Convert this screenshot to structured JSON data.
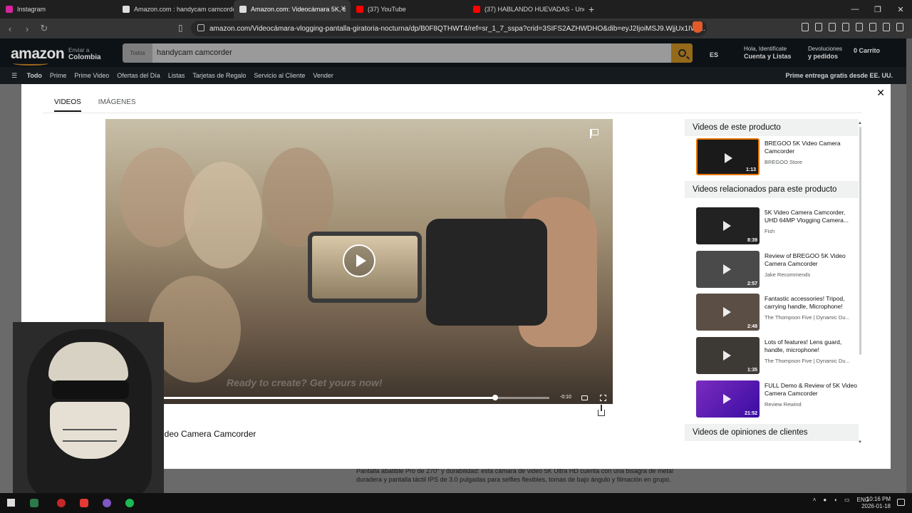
{
  "browser": {
    "tabs": [
      {
        "label": "Instagram",
        "color": "#d6249f"
      },
      {
        "label": "Amazon.com : handycam camcorder",
        "color": "#dddddd"
      },
      {
        "label": "Amazon.com: Videocámara 5K, c",
        "color": "#dddddd"
      },
      {
        "label": "(37) YouTube",
        "color": "#ff0000"
      },
      {
        "label": "(37) HABLANDO HUEVADAS - Undé",
        "color": "#ff0000"
      }
    ],
    "url": "amazon.com/Videocámara-vlogging-pantalla-giratoria-nocturna/dp/B0F8QTHWT4/ref=sr_1_7_sspa?crid=3SIFS2AZHWDHO&dib=eyJ2IjoiMSJ9.WjjUx1IW-..."
  },
  "amazon": {
    "logo": "amazon",
    "deliver_line1": "Enviar a",
    "deliver_line2": "Colombia",
    "search_category": "Todos",
    "search_query": "handycam camcorder",
    "lang": "ES",
    "account_line1": "Hola, Identifícate",
    "account_line2": "Cuenta y Listas",
    "returns_line1": "Devoluciones",
    "returns_line2": "y pedidos",
    "cart_count": "0",
    "cart_label": "Carrito",
    "nav_all": "Todo",
    "nav_items": [
      "Prime",
      "Prime Video",
      "Ofertas del Día",
      "Listas",
      "Tarjetas de Regalo",
      "Servicio al Cliente",
      "Vender"
    ],
    "nav_promo": "Prime entrega gratis desde EE. UU.",
    "behind_text": "Pantalla abatible Pro de 270° y durabilidad: esta cámara de video 5K Ultra HD cuenta con una bisagra de metal duradera y pantalla táctil IPS de 3.0 pulgadas para selfies flexibles, tomas de bajo ángulo y filmación en grupo."
  },
  "modal": {
    "tab_videos": "VIDEOS",
    "tab_images": "IMÁGENES",
    "video_title": "ideo Camera Camcorder",
    "overlay_text": "Ready to create? Get yours now!",
    "time_remaining": "-0:10",
    "progress_fraction": 0.86,
    "section_product": "Videos de este producto",
    "section_related": "Videos relacionados para este producto",
    "section_reviews": "Videos de opiniones de clientes",
    "product_videos": [
      {
        "title": "BREGOO 5K Video Camera Camcorder",
        "source": "BREGOO Store",
        "duration": "1:13"
      }
    ],
    "related_videos": [
      {
        "title": "5K Video Camera Camcorder, UHD 64MP Vlogging Camera...",
        "source": "Fish",
        "duration": "8:39"
      },
      {
        "title": "Review of BREGOO 5K Video Camera Camcorder",
        "source": "Jake Recommends",
        "duration": "2:57"
      },
      {
        "title": "Fantastic accessories! Tripod, carrying handle, Microphone!",
        "source": "The Thompson Five | Dynamic Du...",
        "duration": "2:48"
      },
      {
        "title": "Lots of features! Lens guard, handle, microphone!",
        "source": "The Thompson Five | Dynamic Du...",
        "duration": "1:35"
      },
      {
        "title": "FULL Demo & Review of 5K Video Camera Camcorder",
        "source": "Review Rewind",
        "duration": "21:52"
      }
    ]
  },
  "taskbar": {
    "lang": "ENG",
    "time": "10:16 PM",
    "date": "2026-01-18"
  }
}
